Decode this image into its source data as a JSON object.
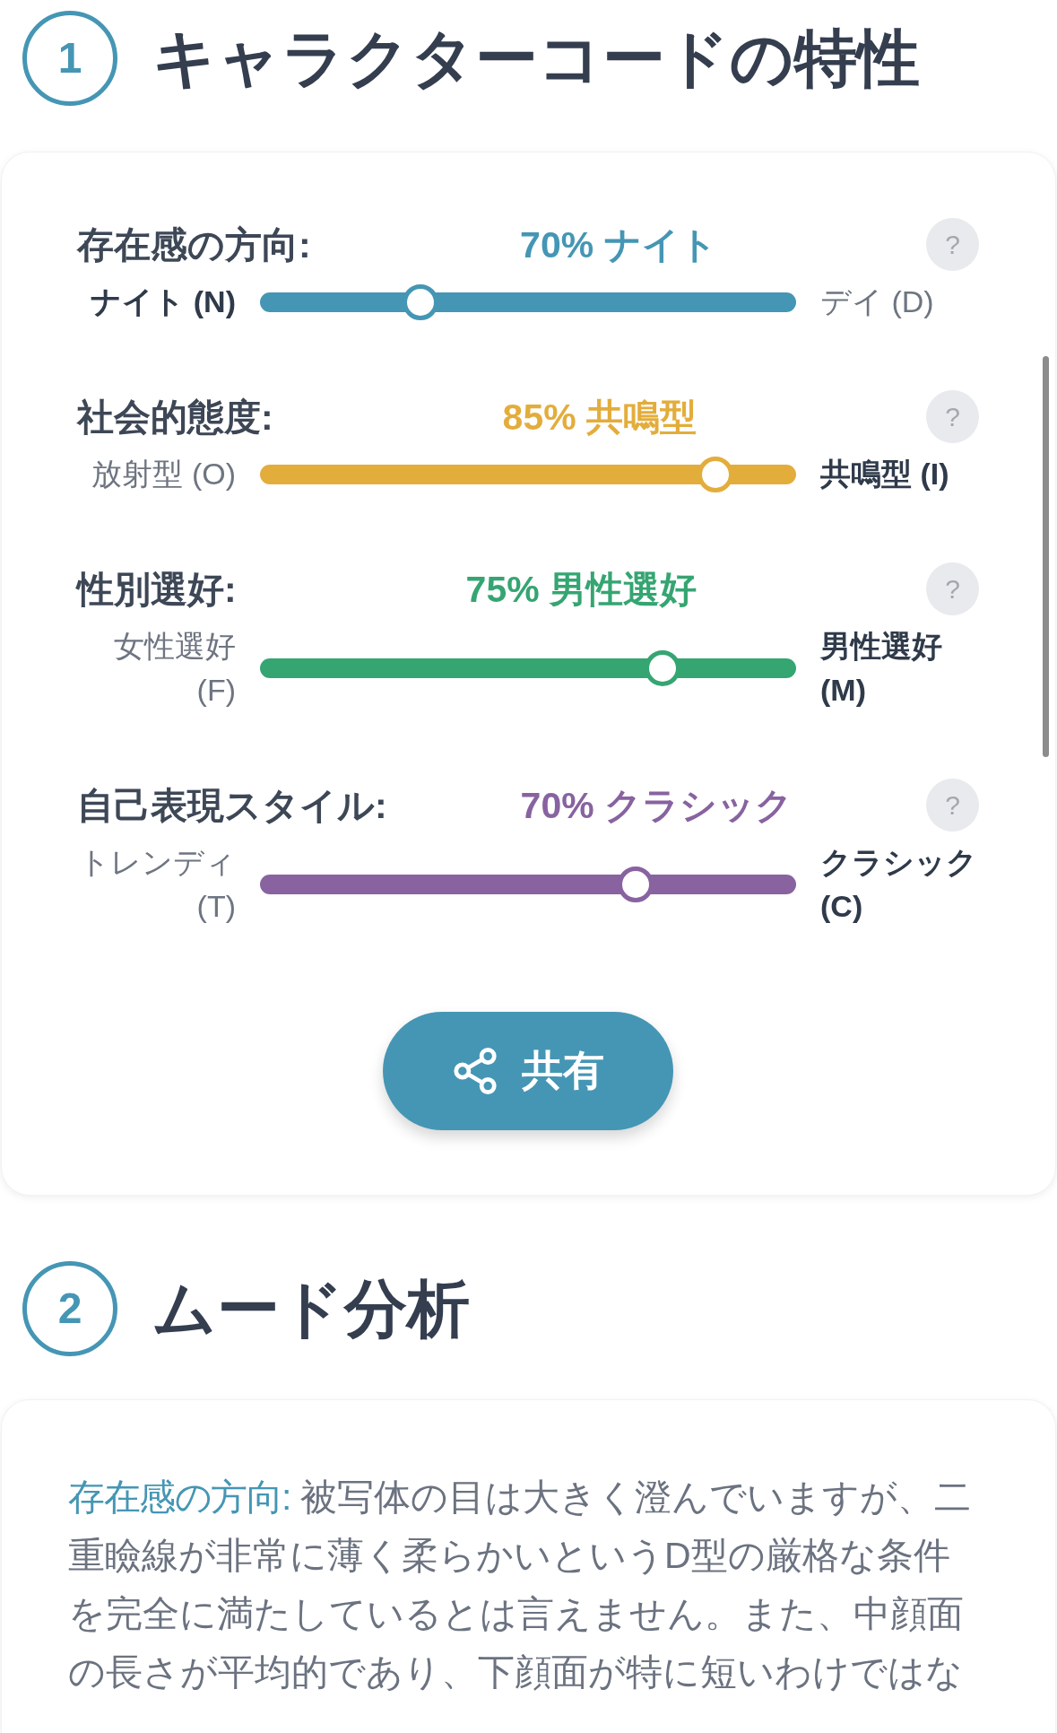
{
  "sections": [
    {
      "kind": "traits",
      "number": "1",
      "title": "キャラクターコードの特性",
      "traits": [
        {
          "name": "存在感の方向:",
          "value": "70% ナイト",
          "color": "#4596b4",
          "left_pole": "ナイト (N)",
          "right_pole": "デイ (D)",
          "level": 0.3,
          "help": "?"
        },
        {
          "name": "社会的態度:",
          "value": "85% 共鳴型",
          "color": "#e3ad3c",
          "left_pole": "放射型 (O)",
          "right_pole": "共鳴型 (I)",
          "level": 0.85,
          "help": "?"
        },
        {
          "name": "性別選好:",
          "value": "75% 男性選好",
          "color": "#35a572",
          "left_pole": "女性選好 (F)",
          "right_pole": "男性選好 (M)",
          "level": 0.75,
          "help": "?"
        },
        {
          "name": "自己表現スタイル:",
          "value": "70% クラシック",
          "color": "#8863a0",
          "left_pole": "トレンディ (T)",
          "right_pole": "クラシック (C)",
          "level": 0.7,
          "help": "?"
        }
      ],
      "share_button": {
        "label": "共有"
      }
    },
    {
      "kind": "text",
      "number": "2",
      "title": "ムード分析",
      "paragraphs": [
        {
          "label": "存在感の方向:",
          "text": "被写体の目は大きく澄んでいますが、二重瞼線が非常に薄く柔らかいというD型の厳格な条件を完全に満たしているとは言えません。また、中顔面の長さが平均的であり、下顔面が特に短いわけではな"
        }
      ]
    }
  ]
}
